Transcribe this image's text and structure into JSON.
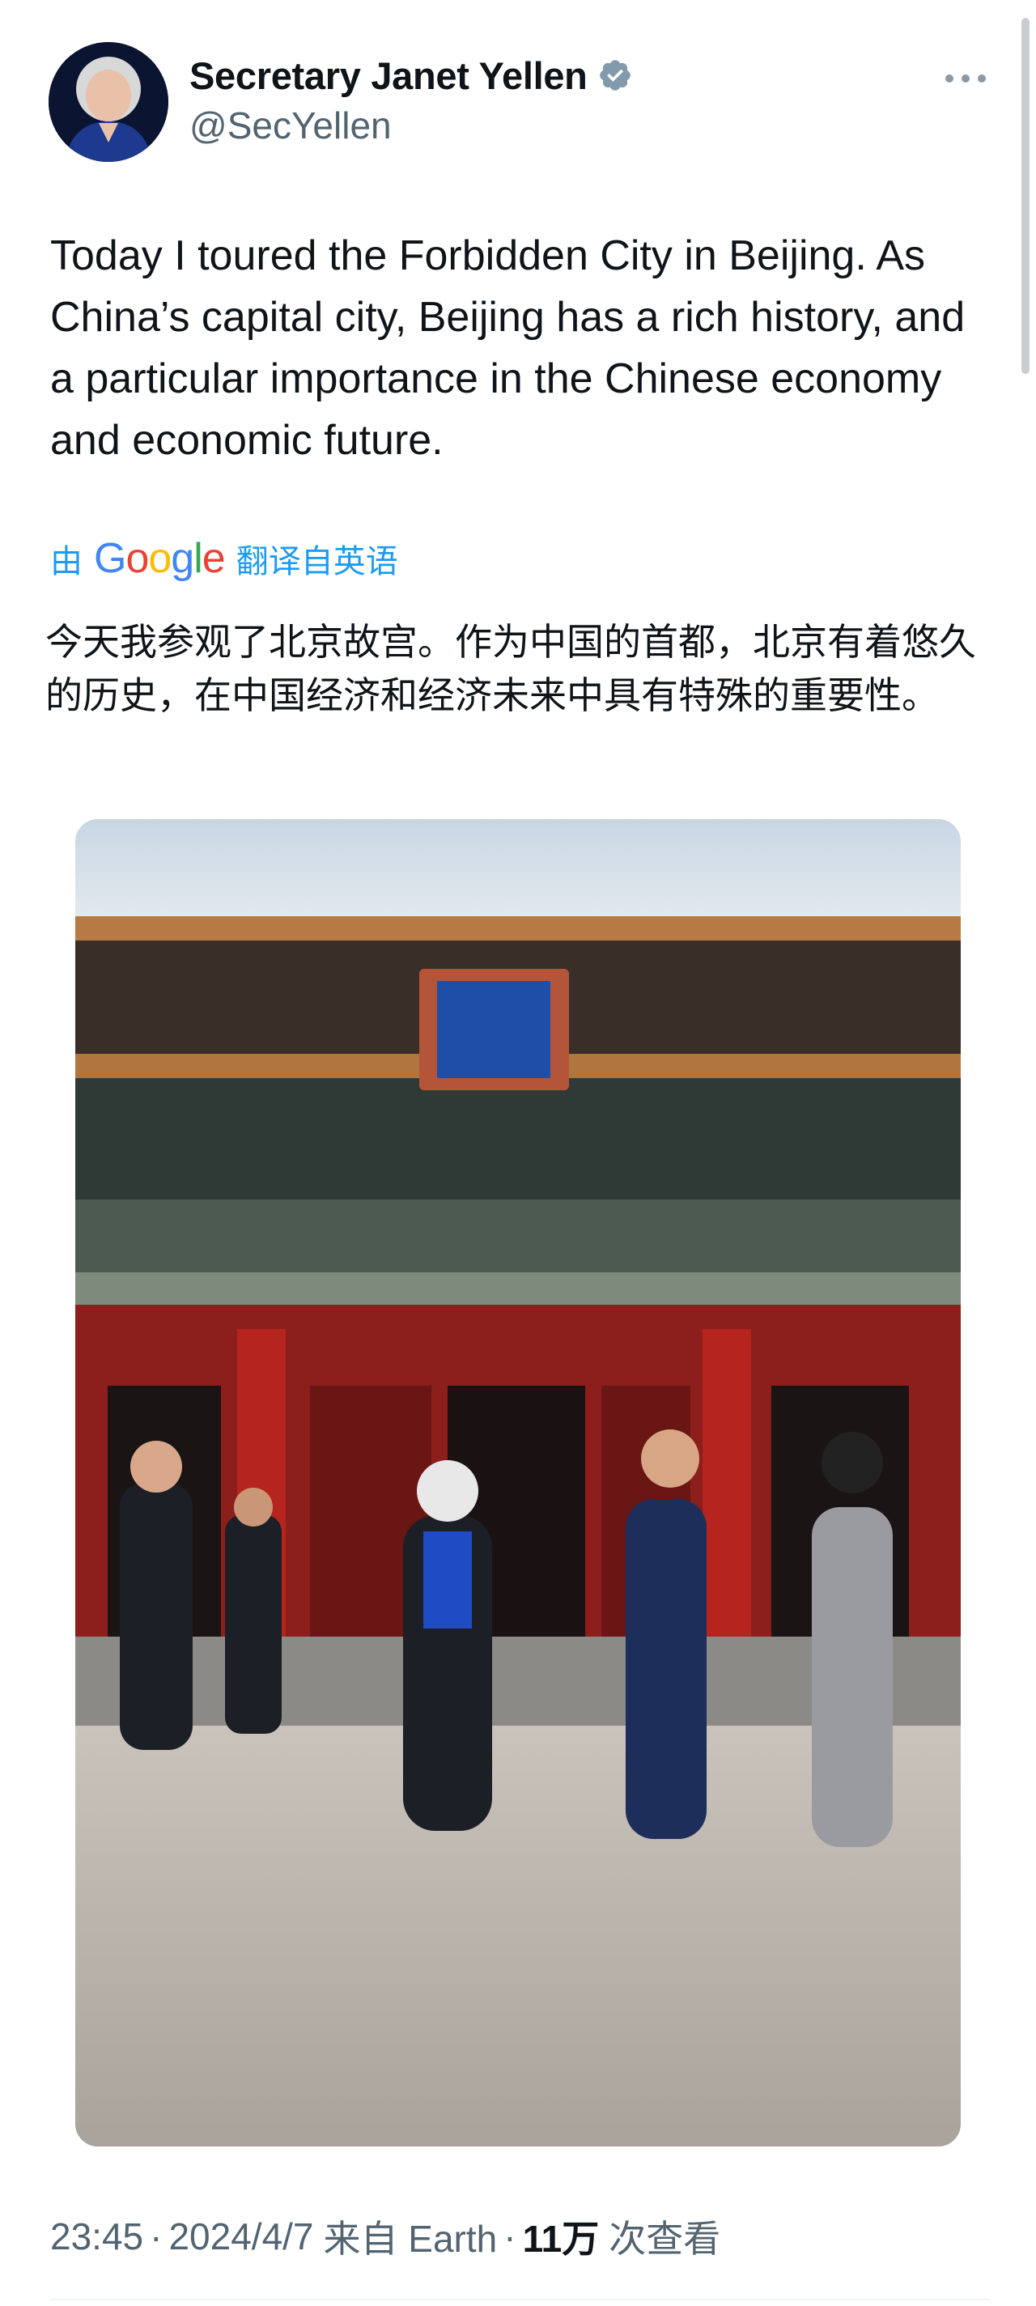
{
  "author": {
    "display_name": "Secretary Janet Yellen",
    "handle": "@SecYellen",
    "verified_icon": "verified-badge-icon",
    "verified_color": "#829aab"
  },
  "tweet": {
    "text": "Today I toured the Forbidden City in Beijing. As China’s capital city, Beijing has a rich history, and a particular importance in the Chinese economy and economic future.",
    "translation": {
      "prefix": "由",
      "logo_text": "Google",
      "suffix": "翻译自英语",
      "text": "今天我参观了北京故宫。作为中国的首都，北京有着悠久的历史，在中国经济和经济未来中具有特殊的重要性。"
    },
    "photo_icon": "forbidden-city-photo"
  },
  "meta": {
    "time": "23:45",
    "separator": "·",
    "date": "2024/4/7",
    "source": "来自 Earth",
    "views_count": "11万",
    "views_label": "次查看"
  },
  "colors": {
    "link": "#1d9bf0",
    "secondary_text": "#536471",
    "primary_text": "#0f1419"
  }
}
